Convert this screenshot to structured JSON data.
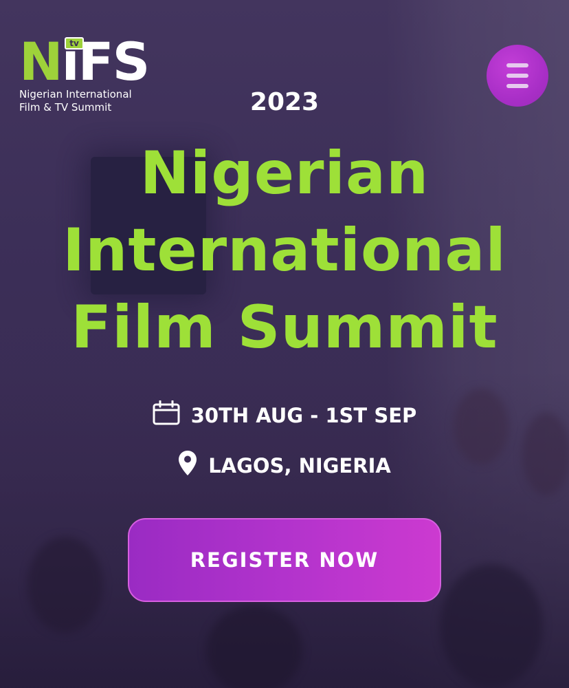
{
  "logo": {
    "mark_n": "N",
    "mark_rest": "iFS",
    "tv": "tv",
    "subtitle_line1": "Nigerian International",
    "subtitle_line2": "Film & TV Summit"
  },
  "header": {
    "menu_icon": "hamburger-icon"
  },
  "hero": {
    "year": "2023",
    "title_line1": "Nigerian",
    "title_line2": "International",
    "title_line3": "Film Summit",
    "date_icon": "calendar-icon",
    "date": "30TH AUG - 1ST SEP",
    "location_icon": "map-pin-icon",
    "location": "LAGOS, NIGERIA",
    "cta": "REGISTER NOW"
  },
  "colors": {
    "accent_green": "#9ee038",
    "accent_purple": "#b233cc",
    "background": "#3a2c53"
  }
}
